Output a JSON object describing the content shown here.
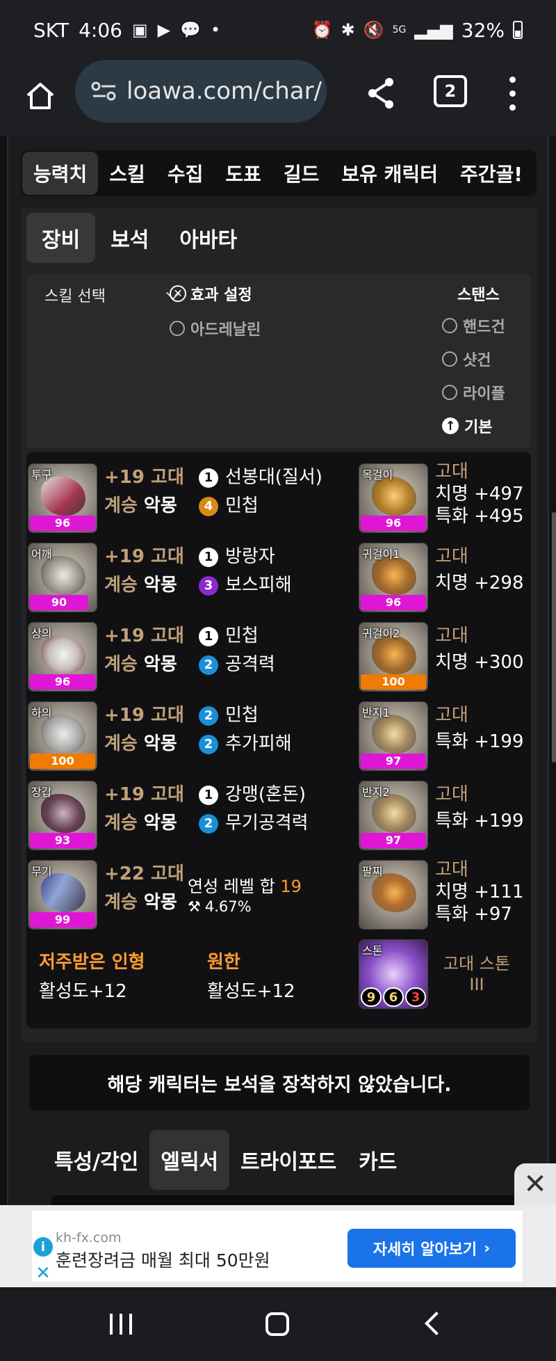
{
  "status_bar": {
    "carrier": "SKT",
    "time": "4:06",
    "battery": "32%",
    "network": "5G"
  },
  "browser": {
    "url": "loawa.com/char/",
    "tab_count": "2"
  },
  "main_tabs": [
    "능력치",
    "스킬",
    "수집",
    "도표",
    "길드",
    "보유 캐릭터",
    "주간골!"
  ],
  "sub_tabs": [
    "장비",
    "보석",
    "아바타"
  ],
  "effect_settings": {
    "skill_select": "스킬 선택",
    "effect_title": "효과 설정",
    "option_adrenaline": "아드레날린",
    "stance_title": "스탠스",
    "stance_options": [
      "핸드건",
      "샷건",
      "라이플"
    ],
    "stance_default": "기본"
  },
  "equipment": [
    {
      "slot": "투구",
      "quality": "96",
      "upgrade": "+19 고대",
      "succession": "계승",
      "set": "악몽",
      "effects": [
        {
          "level": "1",
          "name": "선봉대(질서)"
        },
        {
          "level": "4",
          "name": "민첩"
        }
      ]
    },
    {
      "slot": "어깨",
      "quality": "90",
      "upgrade": "+19 고대",
      "succession": "계승",
      "set": "악몽",
      "effects": [
        {
          "level": "1",
          "name": "방랑자"
        },
        {
          "level": "3",
          "name": "보스피해"
        }
      ]
    },
    {
      "slot": "상의",
      "quality": "96",
      "upgrade": "+19 고대",
      "succession": "계승",
      "set": "악몽",
      "effects": [
        {
          "level": "1",
          "name": "민첩"
        },
        {
          "level": "2",
          "name": "공격력"
        }
      ]
    },
    {
      "slot": "하의",
      "quality": "100",
      "upgrade": "+19 고대",
      "succession": "계승",
      "set": "악몽",
      "effects": [
        {
          "level": "2",
          "name": "민첩"
        },
        {
          "level": "2",
          "name": "추가피해"
        }
      ]
    },
    {
      "slot": "장갑",
      "quality": "93",
      "upgrade": "+19 고대",
      "succession": "계승",
      "set": "악몽",
      "effects": [
        {
          "level": "1",
          "name": "강맹(혼돈)"
        },
        {
          "level": "2",
          "name": "무기공격력"
        }
      ]
    },
    {
      "slot": "무기",
      "quality": "99",
      "upgrade": "+22 고대",
      "succession": "계승",
      "set": "악몽"
    }
  ],
  "refine": {
    "label": "연성 레벨 합",
    "value": "19",
    "percent": "4.67%"
  },
  "accessories": [
    {
      "slot": "목걸이",
      "quality": "96",
      "grade": "고대",
      "stats": [
        "치명 +497",
        "특화 +495"
      ]
    },
    {
      "slot": "귀걸이1",
      "quality": "96",
      "grade": "고대",
      "stats": [
        "치명 +298"
      ]
    },
    {
      "slot": "귀걸이2",
      "quality": "100",
      "grade": "고대",
      "stats": [
        "치명 +300"
      ]
    },
    {
      "slot": "반지1",
      "quality": "97",
      "grade": "고대",
      "stats": [
        "특화 +199"
      ]
    },
    {
      "slot": "반지2",
      "quality": "97",
      "grade": "고대",
      "stats": [
        "특화 +199"
      ]
    },
    {
      "slot": "팔찌",
      "grade": "고대",
      "stats": [
        "치명 +111",
        "특화 +97"
      ]
    }
  ],
  "stone": {
    "slot": "스톤",
    "name": "고대 스톤",
    "tier": "III",
    "gems": [
      "9",
      "6",
      "3"
    ]
  },
  "engravings": [
    {
      "name": "저주받은 인형",
      "activity": "활성도+12"
    },
    {
      "name": "원한",
      "activity": "활성도+12"
    }
  ],
  "notice": "해당 캐릭터는 보석을 장착하지 않았습니다.",
  "bottom_tabs": [
    "특성/각인",
    "엘릭서",
    "트라이포드",
    "카드"
  ],
  "ad": {
    "domain": "kh-fx.com",
    "title": "훈련장려금 매월 최대 50만원",
    "cta": "자세히 알아보기"
  },
  "colors": {
    "quality_pink": "#e016d6",
    "quality_orange": "#f07b00",
    "gold_text": "#c2a178",
    "orange_text": "#ff9b2f"
  }
}
